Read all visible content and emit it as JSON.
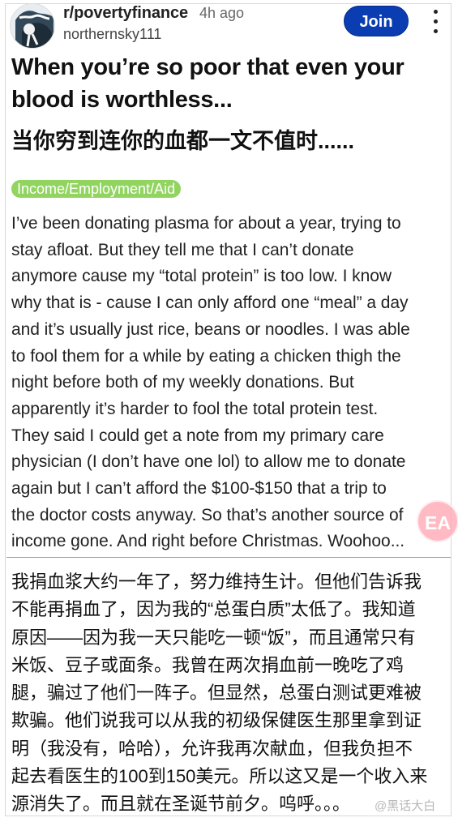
{
  "post": {
    "subreddit": "r/povertyfinance",
    "time": "4h ago",
    "username": "northernsky111",
    "join_label": "Join",
    "title_en": "When you’re so poor that even your blood is worthless...",
    "title_zh": "当你穷到连你的血都一文不值时......",
    "flair": "Income/Employment/Aid",
    "body_en_lines": [
      "I’ve been donating plasma for about a year, trying to",
      "stay afloat. But they tell me that I can’t donate",
      "anymore cause my “total protein” is too low. I know",
      "why that is - cause I can only afford one “meal” a day",
      "and it’s usually just rice, beans or noodles. I was able",
      "to fool them for a while by eating a chicken thigh the",
      "night before both of my weekly donations. But",
      "apparently it’s harder to fool the total protein test.",
      "They said I could get a note from my primary care",
      "physician (I don’t have one lol) to allow me to donate",
      "again but I can’t afford the $100-$150 that a trip to",
      "the doctor costs anyway. So that’s another source of",
      "income gone. And right before Christmas. Woohoo..."
    ],
    "body_zh_lines": [
      "我捐血浆大约一年了，努力维持生计。但他们告诉我",
      "不能再捐血了，因为我的“总蛋白质”太低了。我知道",
      "原因——因为我一天只能吃一顿“饭”，而且通常只有",
      "米饭、豆子或面条。我曾在两次捐血前一晚吃了鸡",
      "腿，骗过了他们一阵子。但显然，总蛋白测试更难被",
      "欺骗。他们说我可以从我的初级保健医生那里拿到证",
      "明（我没有，哈哈），允许我再次献血，但我负担不",
      "起去看医生的100到150美元。所以这又是一个收入来",
      "源消失了。而且就在圣诞节前夕。呜呼。。。"
    ]
  },
  "overlay": {
    "badge_text": "EA",
    "watermark": "@黑话大白"
  },
  "colors": {
    "join": "#0a3db1",
    "flair": "#91d460",
    "badge": "#ffa7b4"
  },
  "icons": {
    "avatar": "avatar",
    "more": "more-icon"
  }
}
